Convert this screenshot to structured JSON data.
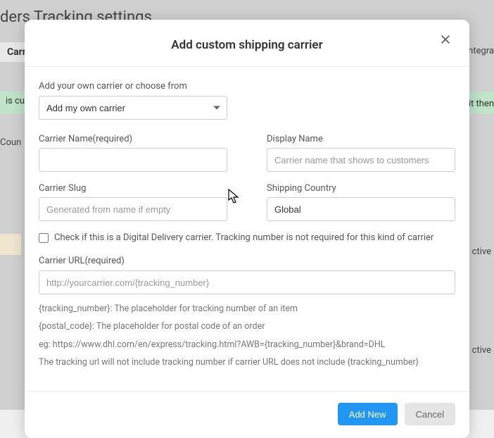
{
  "backdrop": {
    "title": "ders Tracking settings",
    "tabLeft": "Carri",
    "greenLeft": " is cu",
    "sideLabel": "Coun",
    "tabRight": "ntegra",
    "greenRight": "it then",
    "ctve": "ctive"
  },
  "modal": {
    "title": "Add custom shipping carrier",
    "labels": {
      "addCarrier": "Add your own carrier or choose from",
      "carrierName": "Carrier Name(required)",
      "displayName": "Display Name",
      "carrierSlug": "Carrier Slug",
      "shippingCountry": "Shipping Country",
      "digitalDelivery": "Check if this is a Digital Delivery carrier. Tracking number is not required for this kind of carrier",
      "carrierUrl": "Carrier URL(required)"
    },
    "values": {
      "addCarrierSelected": "Add my own carrier",
      "shippingCountry": "Global"
    },
    "placeholders": {
      "displayName": "Carrier name that shows to customers",
      "carrierSlug": "Generated from name if empty",
      "carrierUrl": "http://yourcarrier.com/{tracking_number}"
    },
    "helpText": {
      "line1": "{tracking_number}: The placeholder for tracking number of an item",
      "line2": "{postal_code}: The placeholder for postal code of an order",
      "line3": "eg: https://www.dhl.com/en/express/tracking.html?AWB={tracking_number}&brand=DHL",
      "line4": "The tracking url will not include tracking number if carrier URL does not include {tracking_number}"
    },
    "buttons": {
      "addNew": "Add New",
      "cancel": "Cancel"
    }
  }
}
